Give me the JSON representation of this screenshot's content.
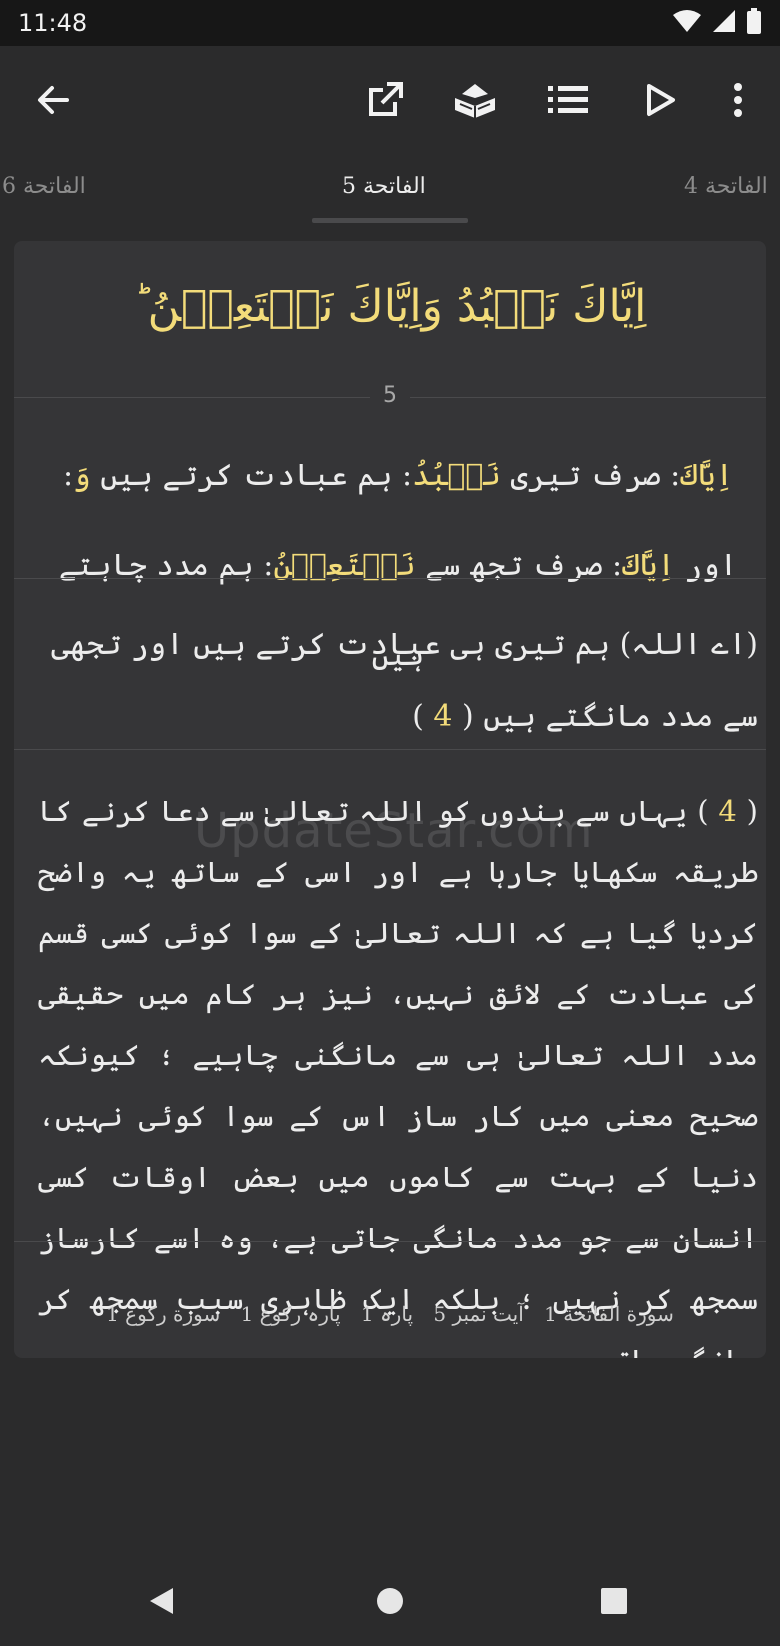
{
  "status_bar": {
    "time": "11:48",
    "icons": [
      "wifi-icon",
      "signal-icon",
      "battery-icon"
    ]
  },
  "toolbar": {
    "icons": [
      "back-arrow-icon",
      "share-icon",
      "quran-book-icon",
      "list-icon",
      "play-icon",
      "more-vert-icon"
    ]
  },
  "tabs": [
    {
      "label": "الفاتحة 6",
      "active": false
    },
    {
      "label": "الفاتحة 5",
      "active": true
    },
    {
      "label": "الفاتحة 4",
      "active": false
    }
  ],
  "verse": {
    "arabic": "اِيَّاكَ نَعۡبُدُ وَاِيَّاكَ نَسۡتَعِيۡنُ ؕ",
    "number": "5",
    "word_by_word": [
      {
        "word": "اِيَّاكَ",
        "meaning": "صرف تیری"
      },
      {
        "word": "نَعۡبُدُ",
        "meaning": "ہم عبادت کرتے ہیں"
      },
      {
        "word": "وَ",
        "meaning": "اور"
      },
      {
        "word": "اِيَّاكَ",
        "meaning": "صرف تجھ سے"
      },
      {
        "word": "نَسۡتَعِيۡنُ",
        "meaning": "ہم مدد چاہتے ہیں"
      }
    ],
    "translation": "(اے اللہ) ہم تیری ہی عبادت کرتے ہیں اور تجھی سے مدد مانگتے ہیں",
    "footnote_ref": "4",
    "tafsir_ref": "4",
    "tafsir": "یہاں سے بندوں کو اللہ تعالیٰ سے دعا کرنے کا طریقہ سکھایا جارہا ہے اور اسی کے ساتھ یہ واضح کردیا گیا ہے کہ اللہ تعالیٰ کے سوا کوئی کسی قسم کی عبادت کے لائق نہیں، نیز ہر کام میں حقیقی مدد اللہ تعالیٰ ہی سے مانگنی چاہیے ؛ کیونکہ صحیح معنی میں کار ساز اس کے سوا کوئی نہیں، دنیا کے بہت سے کاموں میں بعض اوقات کسی انسان سے جو مدد مانگی جاتی ہے، وہ اسے کارساز سمجھ کر نہیں ؛ بلکہ ایک ظاہری سبب سمجھ کر مانگی جاتی ہے۔",
    "watermark": "UpdateStar.com",
    "meta": [
      "سورة الفاتحة 1",
      "آیت نمبر 5",
      "پارہ 1",
      "پارہ رکوع 1",
      "سورة رکوع 1"
    ]
  },
  "nav_bar": {
    "icons": [
      "back-triangle-icon",
      "home-circle-icon",
      "recents-square-icon"
    ]
  },
  "colors": {
    "background": "#2b2b2c",
    "card": "#353537",
    "accent_gold": "#f3dc7a",
    "text": "#ececec"
  }
}
